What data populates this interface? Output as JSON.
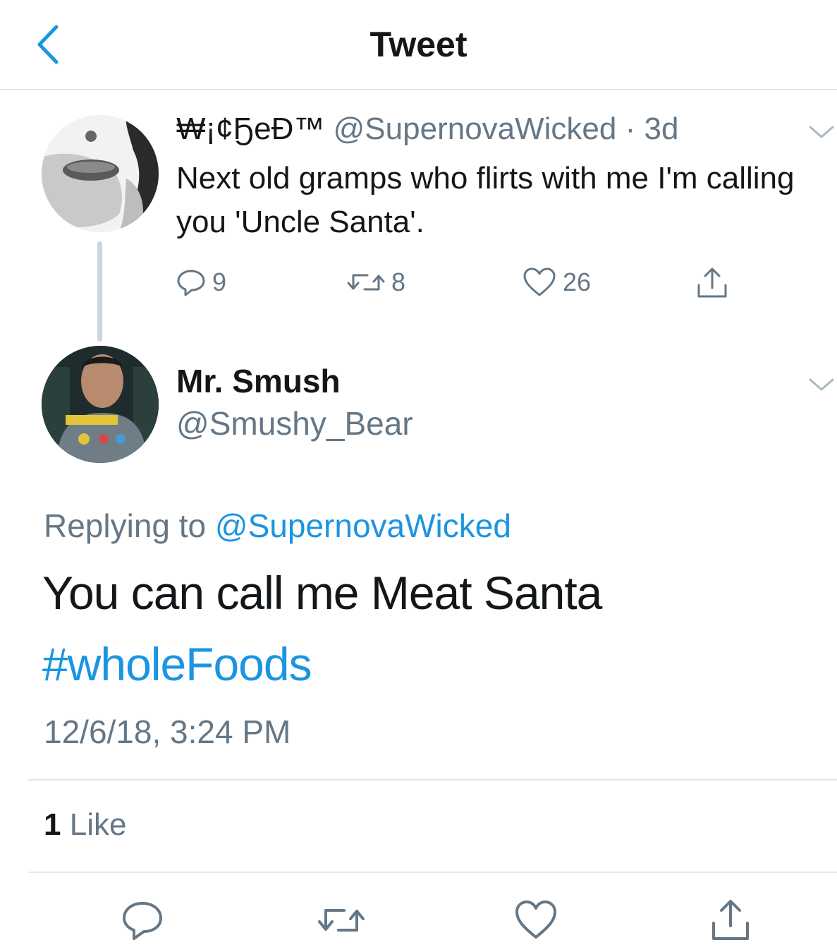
{
  "navbar": {
    "title": "Tweet",
    "back_icon": "chevron-left-icon"
  },
  "parent_tweet": {
    "display_name": "₩¡¢ҔeĐ™",
    "handle": "@SupernovaWicked",
    "separator": "·",
    "time": "3d",
    "text": "Next old gramps who flirts with me I'm calling you 'Uncle Santa'.",
    "replies": "9",
    "retweets": "8",
    "likes": "26"
  },
  "reply_tweet": {
    "display_name": "Mr. Smush",
    "handle": "@Smushy_Bear",
    "replying_prefix": "Replying to",
    "replying_to": "@SupernovaWicked",
    "text": "You can call me Meat Santa",
    "hashtag": "#wholeFoods",
    "timestamp": "12/6/18, 3:24 PM",
    "likes_count": "1",
    "likes_label": "Like"
  },
  "colors": {
    "link": "#1b95e0",
    "secondary_text": "#657786",
    "divider": "#e1e8ed",
    "primary_text": "#14171a"
  }
}
